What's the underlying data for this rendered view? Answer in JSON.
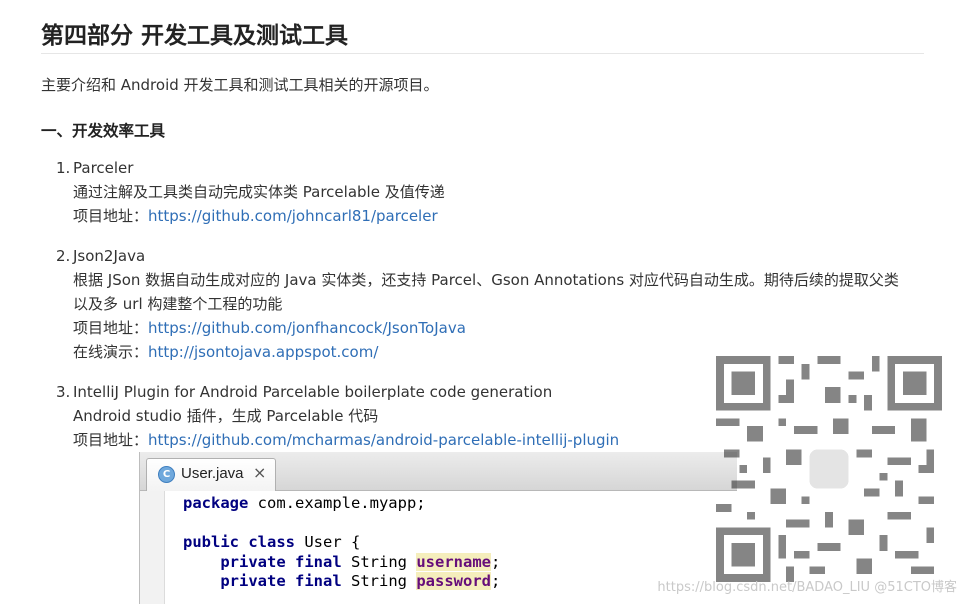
{
  "page": {
    "title": "第四部分 开发工具及测试工具",
    "intro": "主要介绍和 Android 开发工具和测试工具相关的开源项目。",
    "section_heading": "一、开发效率工具"
  },
  "items": [
    {
      "number": "1.",
      "name": "Parceler",
      "lines": [
        "通过注解及工具类自动完成实体类 Parcelable 及值传递"
      ],
      "links": [
        {
          "label": "项目地址：",
          "url_text": "https://github.com/johncarl81/parceler"
        }
      ]
    },
    {
      "number": "2.",
      "name": "Json2Java",
      "lines": [
        "根据 JSon 数据自动生成对应的 Java 实体类，还支持 Parcel、Gson Annotations 对应代码自动生成。期待后续的提取父类",
        "以及多 url 构建整个工程的功能"
      ],
      "links": [
        {
          "label": "项目地址：",
          "url_text": "https://github.com/jonfhancock/JsonToJava"
        },
        {
          "label": "在线演示：",
          "url_text": "http://jsontojava.appspot.com/"
        }
      ]
    },
    {
      "number": "3.",
      "name": "IntelliJ Plugin for Android Parcelable boilerplate code generation",
      "lines": [
        "Android studio 插件，生成 Parcelable 代码"
      ],
      "links": [
        {
          "label": "项目地址：",
          "url_text": "https://github.com/mcharmas/android-parcelable-intellij-plugin"
        }
      ]
    }
  ],
  "ide": {
    "tab_icon_letter": "C",
    "tab_label": "User.java",
    "tab_close": "×",
    "code": {
      "line1_kw": "package",
      "line1_rest": " com.example.myapp;",
      "line3_kw1": "public",
      "line3_kw2": "class",
      "line3_rest": " User {",
      "line4_kw1": "private",
      "line4_kw2": "final",
      "line4_type": " String ",
      "line4_field": "username",
      "line5_kw1": "private",
      "line5_kw2": "final",
      "line5_type": " String ",
      "line5_field": "password",
      "semicolon": ";"
    }
  },
  "watermark": "https://blog.csdn.net/BADAO_LIU @51CTO博客",
  "colors": {
    "link": "#2f6eb6",
    "keyword": "#000080",
    "field_highlight": "#f5eebc"
  }
}
